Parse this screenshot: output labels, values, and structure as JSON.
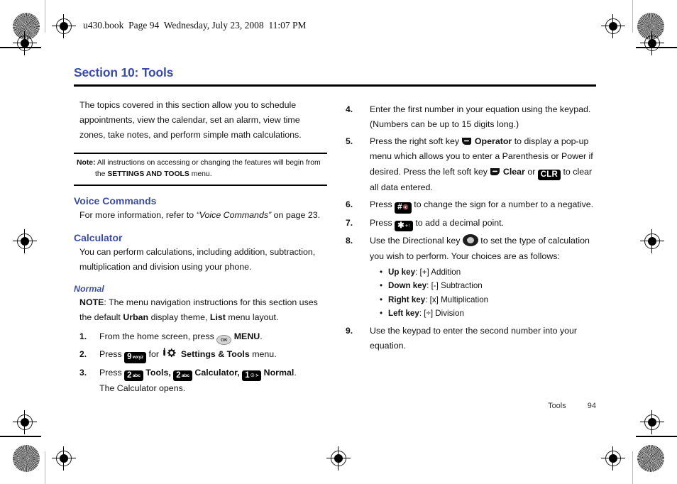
{
  "running_header": "u430.book  Page 94  Wednesday, July 23, 2008  11:07 PM",
  "section": {
    "title": "Section 10: Tools",
    "accent_color": "#3b4ca8"
  },
  "intro": "The topics covered in this section allow you to schedule appointments, view the calendar, set an alarm, view time zones, take notes, and perform simple math calculations.",
  "note": {
    "label": "Note:",
    "text_1": " All instructions on accessing or changing the features will begin from",
    "text_2_pre": "the ",
    "text_2_bold": "SETTINGS AND TOOLS",
    "text_2_post": " menu."
  },
  "voice_commands": {
    "heading": "Voice Commands",
    "body_pre": "For more information, refer to ",
    "body_italic": "“Voice Commands”",
    "body_post": " on page 23."
  },
  "calculator": {
    "heading": "Calculator",
    "body": "You can perform calculations, including addition, subtraction, multiplication and division using your phone.",
    "normal_heading": "Normal",
    "note_label": "NOTE",
    "note_pre": ": The menu navigation instructions for this section uses the default ",
    "note_bold_1": "Urban",
    "note_mid": " display theme, ",
    "note_bold_2": "List",
    "note_post": " menu layout."
  },
  "steps_left": [
    {
      "num": "1.",
      "pre": "From the home screen, press ",
      "key": {
        "type": "ok",
        "label": "OK"
      },
      "post_bold": "MENU",
      "post": "."
    },
    {
      "num": "2.",
      "pre": "Press ",
      "key": {
        "type": "keycap",
        "big": "9",
        "sml": "wxyz"
      },
      "mid": " for ",
      "icon": "settings-tools-icon",
      "post_bold": "Settings & Tools",
      "post": " menu."
    },
    {
      "num": "3.",
      "pre": "Press ",
      "key": {
        "type": "keycap",
        "big": "2",
        "sml": "abc"
      },
      "post_bold": "Tools,",
      "key2": {
        "type": "keycap",
        "big": "2",
        "sml": "abc"
      },
      "post_bold_2": "Calculator,",
      "key3": {
        "type": "keycap",
        "big": "1",
        "sml": "☉ ∶•"
      },
      "post_bold_3": "Normal",
      "post": ".",
      "line2": "The Calculator opens."
    }
  ],
  "steps_right": [
    {
      "num": "4.",
      "text": "Enter the first number in your equation using the keypad. (Numbers can be up to 15 digits long.)"
    },
    {
      "num": "5.",
      "pre": "Press the right soft key ",
      "softkey": "right-soft-key-icon",
      "bold_1": "Operator",
      "mid_1": " to display a pop-up menu which allows you to enter a Parenthesis or Power if desired. Press the left soft key ",
      "softkey_2": "left-soft-key-icon",
      "bold_2": "Clear",
      "mid_2": " or ",
      "clr_key": "CLR",
      "post": " to clear all data entered."
    },
    {
      "num": "6.",
      "pre": "Press ",
      "key": {
        "type": "keycap",
        "big": "#",
        "sml": "🔇"
      },
      "post": " to change the sign for a number to a negative."
    },
    {
      "num": "7.",
      "pre": "Press ",
      "key": {
        "type": "keycap",
        "big": "✱",
        "sml": "+↑"
      },
      "post": " to add a decimal point."
    },
    {
      "num": "8.",
      "pre": "Use the Directional key ",
      "dirkey": "directional-key-icon",
      "post": " to set the type of calculation you wish to perform. Your choices are as follows:"
    },
    {
      "num": "9.",
      "text": "Use the keypad to enter the second number into your equation."
    }
  ],
  "direction_bullets": [
    {
      "bold": "Up key",
      "text": ": [+] Addition"
    },
    {
      "bold": "Down key",
      "text": ": [-] Subtraction"
    },
    {
      "bold": "Right key",
      "text": ": [x] Multiplication"
    },
    {
      "bold": "Left key",
      "text": ": [÷] Division"
    }
  ],
  "footer": {
    "label": "Tools",
    "page_number": "94"
  }
}
